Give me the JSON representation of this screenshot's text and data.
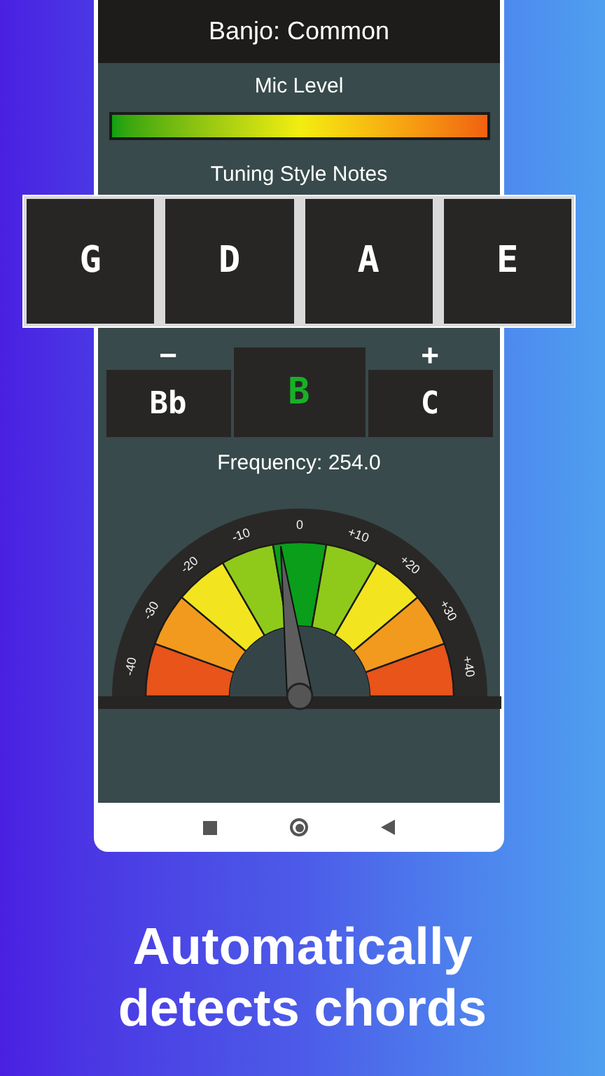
{
  "header": {
    "title": "Banjo: Common"
  },
  "mic": {
    "label": "Mic Level",
    "level": 1
  },
  "tuning": {
    "label": "Tuning Style Notes",
    "notes": [
      "G",
      "D",
      "A",
      "E"
    ]
  },
  "note_picker": {
    "minus": "−",
    "plus": "+",
    "flat": "Bb",
    "current": {
      "label": "B",
      "in_tune": true
    },
    "sharp": "C"
  },
  "frequency": "Frequency: 254.0",
  "gauge": {
    "labels": [
      "-40",
      "-30",
      "-20",
      "-10",
      "0",
      "+10",
      "+20",
      "+30",
      "+40"
    ]
  },
  "headline": [
    "Automatically",
    "detects chords"
  ]
}
